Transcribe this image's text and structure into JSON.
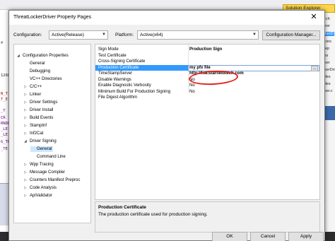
{
  "ide": {
    "left_code": [
      "#",
      "1260",
      "N_T",
      "T_E",
      "_T",
      "CR",
      "RNDE",
      "_LE",
      "_LE",
      "G_TE",
      "_TE"
    ],
    "solution_explorer": {
      "title": "Solution Explorer",
      "items": [
        "arch",
        "lorer",
        "ekerD",
        "ncies",
        "Dep",
        "iles",
        "oker",
        "ekerDri",
        "Files",
        "Files",
        "oker.c"
      ]
    }
  },
  "dialog": {
    "title": "ThreatLockerDriver Property Pages",
    "close_glyph": "✕",
    "configuration_label": "Configuration:",
    "configuration_value": "Active(Release)",
    "platform_label": "Platform:",
    "platform_value": "Active(x64)",
    "config_manager_label": "Configuration Manager...",
    "tree": [
      {
        "label": "Configuration Properties",
        "expander": "◢",
        "indent": 0
      },
      {
        "label": "General",
        "indent": 1
      },
      {
        "label": "Debugging",
        "indent": 1
      },
      {
        "label": "VC++ Directories",
        "indent": 1
      },
      {
        "label": "C/C++",
        "expander": "▷",
        "indent": 1
      },
      {
        "label": "Linker",
        "expander": "▷",
        "indent": 1
      },
      {
        "label": "Driver Settings",
        "expander": "▷",
        "indent": 1
      },
      {
        "label": "Driver Install",
        "expander": "▷",
        "indent": 1
      },
      {
        "label": "Build Events",
        "expander": "▷",
        "indent": 1
      },
      {
        "label": "StampInf",
        "expander": "▷",
        "indent": 1
      },
      {
        "label": "Inf2Cat",
        "expander": "▷",
        "indent": 1
      },
      {
        "label": "Driver Signing",
        "expander": "◢",
        "indent": 1
      },
      {
        "label": "General",
        "indent": 2,
        "selected": true
      },
      {
        "label": "Command Line",
        "indent": 2
      },
      {
        "label": "Wpp Tracing",
        "expander": "▷",
        "indent": 1
      },
      {
        "label": "Message Compiler",
        "expander": "▷",
        "indent": 1
      },
      {
        "label": "Counters Manifest Preproc",
        "expander": "▷",
        "indent": 1
      },
      {
        "label": "Code Analysis",
        "expander": "▷",
        "indent": 1
      },
      {
        "label": "ApiValidator",
        "expander": "▷",
        "indent": 1
      }
    ],
    "properties": [
      {
        "name": "Sign Mode",
        "value": "Production Sign",
        "bold": true
      },
      {
        "name": "Test Certificate",
        "value": ""
      },
      {
        "name": "Cross-Signing Certificate",
        "value": ""
      },
      {
        "name": "Production Certificate",
        "value": "my pfx file",
        "bold": true,
        "selected": true
      },
      {
        "name": "TimeStampServer",
        "value": "http://tsa.starfieldtech.com",
        "bold": true
      },
      {
        "name": "Disable Warnings",
        "value": "No"
      },
      {
        "name": "Enable Diagnostic Verbosity",
        "value": "No"
      },
      {
        "name": "Minimum Build For Production Signing",
        "value": "No"
      },
      {
        "name": "File Digest Algorithm",
        "value": ""
      }
    ],
    "ellipsis_label": "...",
    "description": {
      "title": "Production Certificate",
      "text": "The production certificate used for production signing."
    },
    "buttons": {
      "ok": "OK",
      "cancel": "Cancel",
      "apply": "Apply"
    },
    "annotation_color": "#e0251b",
    "selection_color": "#3399ff"
  }
}
